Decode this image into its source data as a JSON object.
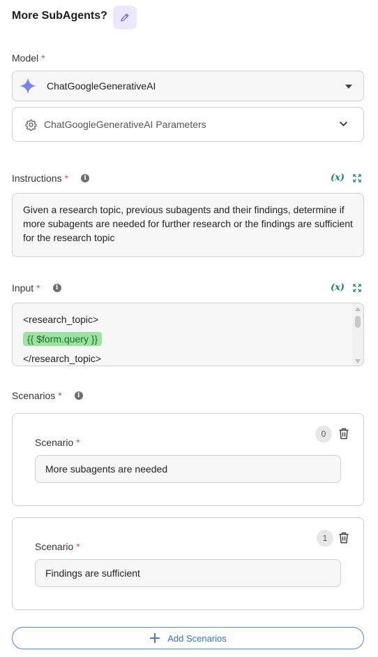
{
  "header": {
    "title": "More SubAgents?"
  },
  "model": {
    "label": "Model",
    "required": "*",
    "selected": "ChatGoogleGenerativeAI",
    "params_label": "ChatGoogleGenerativeAI Parameters"
  },
  "instructions": {
    "label": "Instructions",
    "required": "*",
    "info": "i",
    "variable_button": "(x)",
    "text": "Given a research topic, previous subagents and their findings, determine if more subagents are needed for further research or the findings are sufficient for the research topic"
  },
  "input": {
    "label": "Input",
    "required": "*",
    "info": "i",
    "variable_button": "(x)",
    "line1": "<research_topic>",
    "variable_chip": "{{ $form.query }}",
    "line3": "</research_topic>"
  },
  "scenarios": {
    "label": "Scenarios",
    "required": "*",
    "info": "i",
    "items": [
      {
        "index": "0",
        "label": "Scenario",
        "required": "*",
        "value": "More subagents are needed"
      },
      {
        "index": "1",
        "label": "Scenario",
        "required": "*",
        "value": "Findings are sufficient"
      }
    ],
    "add_label": "Add Scenarios"
  },
  "colors": {
    "accent_teal": "#1a7f8e",
    "required_red": "#e5484d",
    "add_blue": "#2f6fd8",
    "chip_green": "#9ae3a0"
  }
}
